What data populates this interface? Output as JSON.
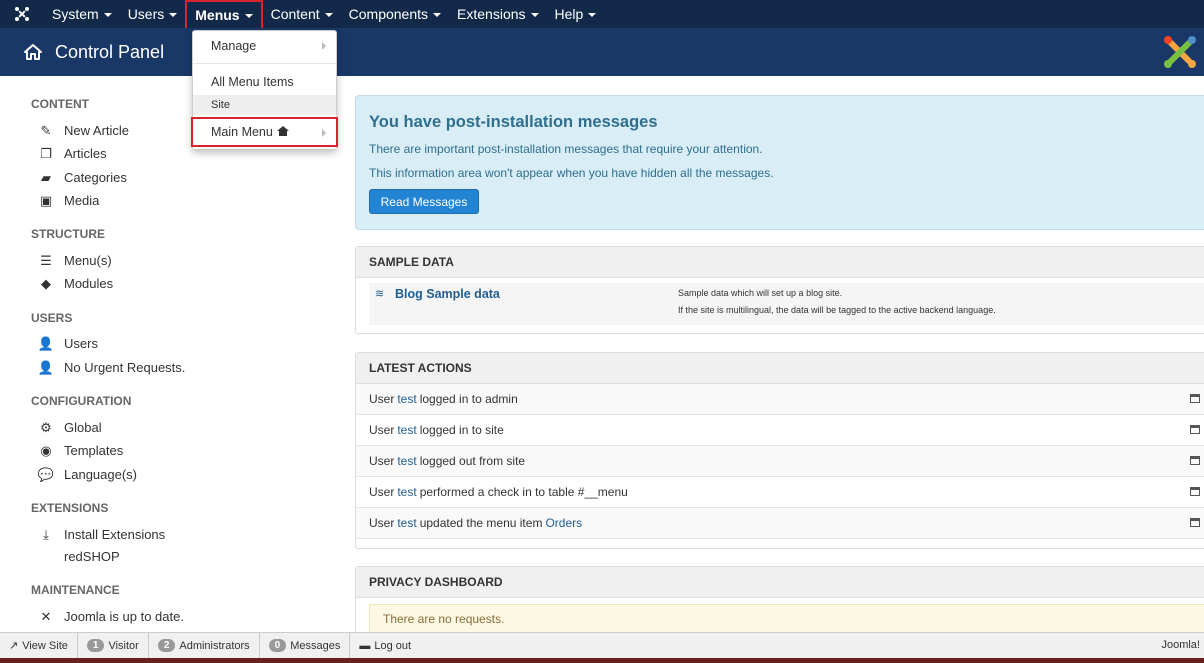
{
  "nav": {
    "items": [
      {
        "label": "System"
      },
      {
        "label": "Users"
      },
      {
        "label": "Menus"
      },
      {
        "label": "Content"
      },
      {
        "label": "Components"
      },
      {
        "label": "Extensions"
      },
      {
        "label": "Help"
      }
    ]
  },
  "header": {
    "title": "Control Panel"
  },
  "menus_dropdown": {
    "manage": "Manage",
    "all_items": "All Menu Items",
    "site_header": "Site",
    "main_menu": "Main Menu"
  },
  "sidebar": {
    "content_heading": "CONTENT",
    "new_article": "New Article",
    "articles": "Articles",
    "categories": "Categories",
    "media": "Media",
    "structure_heading": "STRUCTURE",
    "menus": "Menu(s)",
    "modules": "Modules",
    "users_heading": "USERS",
    "users": "Users",
    "requests": "No Urgent Requests.",
    "config_heading": "CONFIGURATION",
    "global": "Global",
    "templates": "Templates",
    "languages": "Language(s)",
    "ext_heading": "EXTENSIONS",
    "install": "Install Extensions",
    "redshop": "redSHOP",
    "maint_heading": "MAINTENANCE",
    "joomla_status": "Joomla is up to date."
  },
  "postinstall": {
    "title": "You have post-installation messages",
    "line1": "There are important post-installation messages that require your attention.",
    "line2": "This information area won't appear when you have hidden all the messages.",
    "button": "Read Messages"
  },
  "sample_data": {
    "heading": "SAMPLE DATA",
    "link": "Blog Sample data",
    "desc1": "Sample data which will set up a blog site.",
    "desc2": "If the site is multilingual, the data will be tagged to the active backend language."
  },
  "latest_actions": {
    "heading": "LATEST ACTIONS",
    "rows": [
      {
        "prefix": "User",
        "user": "test",
        "text": "logged in to admin",
        "link": ""
      },
      {
        "prefix": "User",
        "user": "test",
        "text": "logged in to site",
        "link": ""
      },
      {
        "prefix": "User",
        "user": "test",
        "text": "logged out from site",
        "link": ""
      },
      {
        "prefix": "User",
        "user": "test",
        "text": "performed a check in to table #__menu",
        "link": ""
      },
      {
        "prefix": "User",
        "user": "test",
        "text": "updated the menu item",
        "link": "Orders"
      }
    ]
  },
  "privacy": {
    "heading": "PRIVACY DASHBOARD",
    "message": "There are no requests."
  },
  "status": {
    "view_site": "View Site",
    "visitors_count": "1",
    "visitors_label": "Visitor",
    "admins_count": "2",
    "admins_label": "Administrators",
    "messages_count": "0",
    "messages_label": "Messages",
    "logout": "Log out",
    "brand": "Joomla!"
  }
}
